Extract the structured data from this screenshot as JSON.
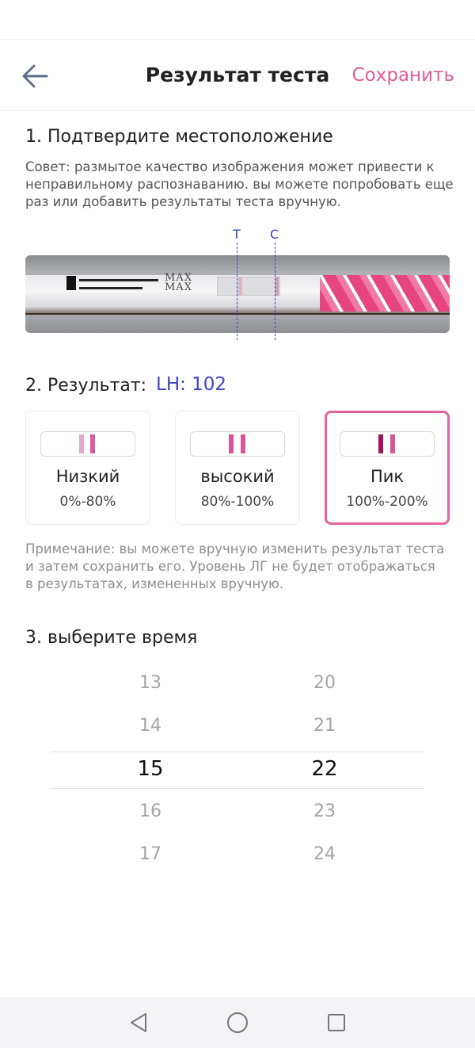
{
  "header": {
    "title": "Результат теста",
    "save_label": "Сохранить",
    "back_icon": "arrow-left-icon"
  },
  "location": {
    "heading": "1. Подтвердите местоположение",
    "tip": "Совет: размытое качество изображения может привести к неправильному распознаванию. вы можете попробовать еще раз или добавить результаты теста вручную.",
    "t_label": "T",
    "c_label": "C",
    "strip_print": [
      "MAX",
      "MAX"
    ]
  },
  "result": {
    "heading": "2. Результат:",
    "lh_value": "LH: 102",
    "cards": [
      {
        "label": "Низкий",
        "range": "0%-80%",
        "line_color": "#e7a6cc",
        "control_color": "#d95aa0",
        "selected": false
      },
      {
        "label": "высокий",
        "range": "80%-100%",
        "line_color": "#d9549b",
        "control_color": "#d9549b",
        "selected": false
      },
      {
        "label": "Пик",
        "range": "100%-200%",
        "line_color": "#a3125f",
        "control_color": "#d9549b",
        "selected": true
      }
    ],
    "note": "Примечание: вы можете вручную изменить результат теста и затем сохранить его. Уровень ЛГ не будет отображаться в результатах, измененных вручную."
  },
  "time": {
    "heading": "3. выберите время",
    "hours": [
      "13",
      "14",
      "15",
      "16",
      "17"
    ],
    "minutes": [
      "20",
      "21",
      "22",
      "23",
      "24"
    ],
    "selected_hour": "15",
    "selected_minute": "22"
  },
  "nav": {
    "back_icon": "triangle-back-icon",
    "home_icon": "circle-home-icon",
    "recents_icon": "square-recents-icon"
  },
  "colors": {
    "accent_pink": "#e15b97",
    "accent_blue": "#3e43c7"
  }
}
